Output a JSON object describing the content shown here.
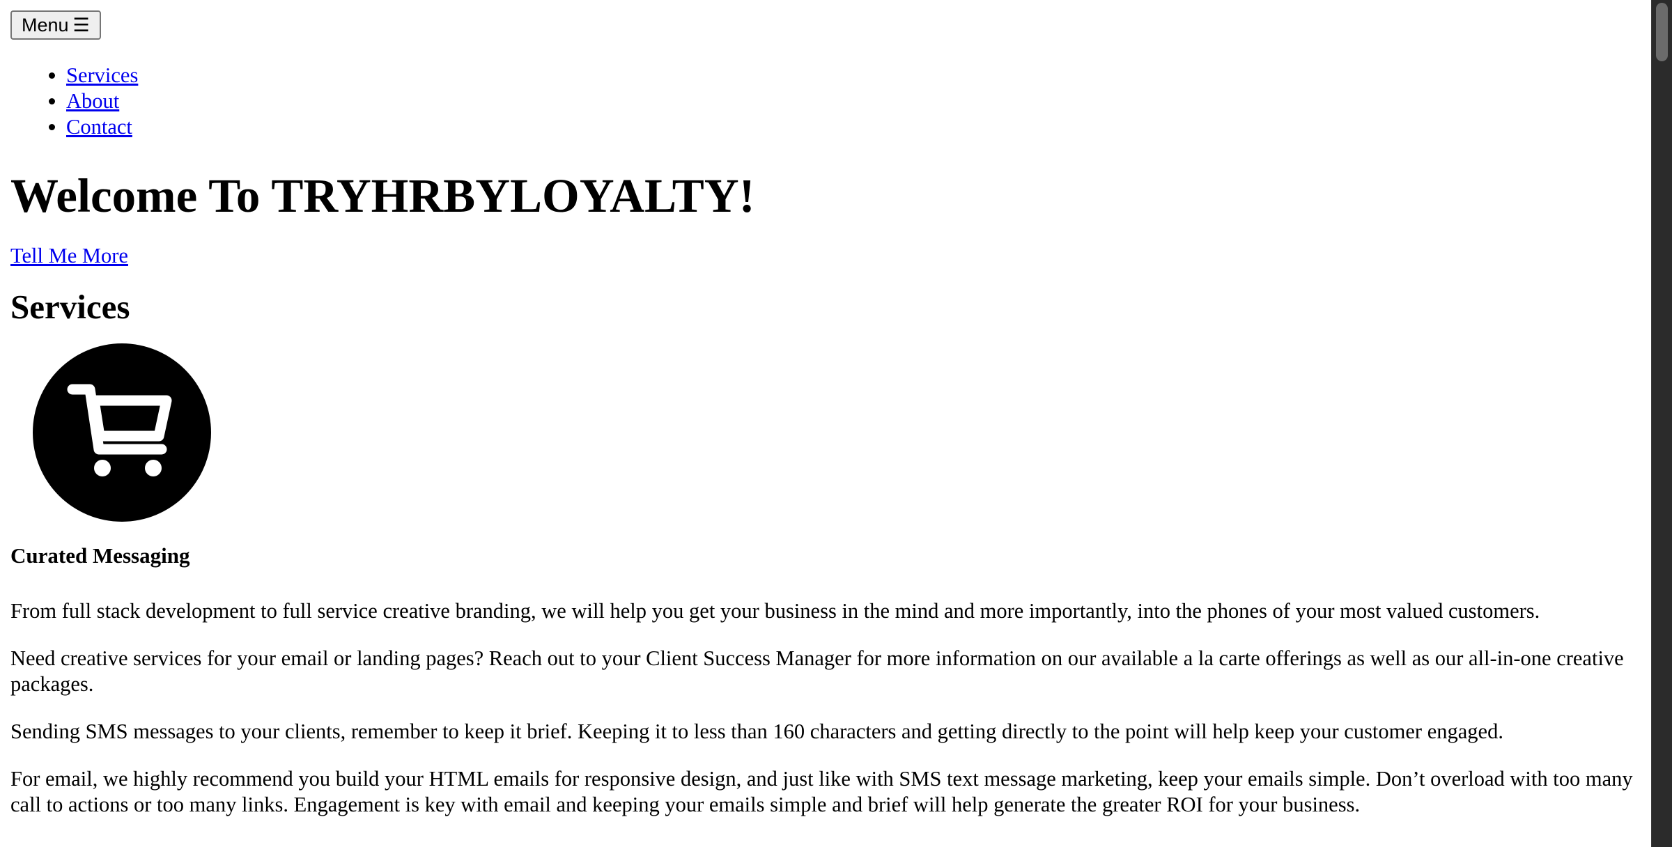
{
  "header": {
    "menu_label": "Menu",
    "menu_icon": "☰"
  },
  "nav": {
    "items": [
      {
        "label": "Services"
      },
      {
        "label": "About"
      },
      {
        "label": "Contact"
      }
    ]
  },
  "hero": {
    "title": "Welcome To TRYHRBYLOYALTY!",
    "cta_label": "Tell Me More"
  },
  "services": {
    "heading": "Services",
    "icon": "shopping-cart-icon",
    "item_title": "Curated Messaging",
    "paragraphs": [
      "From full stack development to full service creative branding, we will help you get your business in the mind and more importantly, into the phones of your most valued customers.",
      "Need creative services for your email or landing pages? Reach out to your Client Success Manager for more information on our available a la carte offerings as well as our all-in-one creative packages.",
      "Sending SMS messages to your clients, remember to keep it brief. Keeping it to less than 160 characters and getting directly to the point will help keep your customer engaged.",
      "For email, we highly recommend you build your HTML emails for responsive design, and just like with SMS text message marketing, keep your emails simple. Don’t overload with too many call to actions or too many links. Engagement is key with email and keeping your emails simple and brief will help generate the greater ROI for your business."
    ]
  },
  "colors": {
    "link": "#0000ee",
    "text": "#000000",
    "background": "#ffffff",
    "scrollbar_track": "#2b2b2b",
    "scrollbar_thumb": "#6b6b6b"
  }
}
